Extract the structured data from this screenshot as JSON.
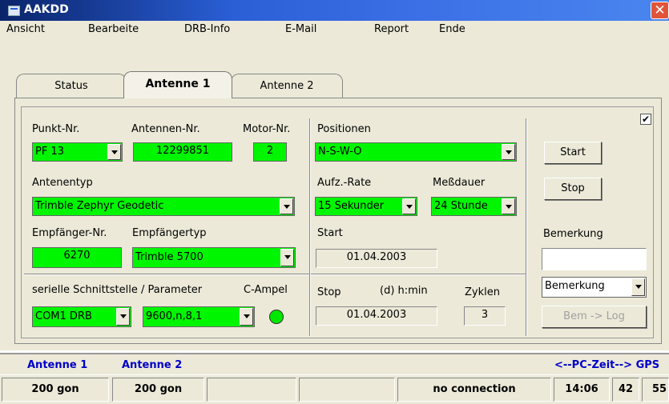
{
  "window": {
    "title": "AAKDD",
    "close_glyph": "✕"
  },
  "menu": [
    "Ansicht",
    "Bearbeite",
    "DRB-Info",
    "E-Mail",
    "Report",
    "Ende"
  ],
  "tabs": [
    {
      "label": "Status",
      "active": false
    },
    {
      "label": "Antenne 1",
      "active": true
    },
    {
      "label": "Antenne 2",
      "active": false
    }
  ],
  "form": {
    "punkt_label": "Punkt-Nr.",
    "punkt_value": "PF 13",
    "antennen_nr_label": "Antennen-Nr.",
    "antennen_nr_value": "12299851",
    "motor_label": "Motor-Nr.",
    "motor_value": "2",
    "antennentyp_label": "Antenentyp",
    "antennentyp_value": "Trimble Zephyr Geodetic",
    "empf_nr_label": "Empfänger-Nr.",
    "empf_nr_value": "6270",
    "empf_typ_label": "Empfängertyp",
    "empf_typ_value": "Trimble 5700",
    "seriell_label": "serielle Schnittstelle / Parameter",
    "com_value": "COM1 DRB",
    "params_value": "9600,n,8,1",
    "ampel_label": "C-Ampel",
    "positionen_label": "Positionen",
    "positionen_value": "N-S-W-O",
    "rate_label": "Aufz.-Rate",
    "rate_value": "15 Sekunder",
    "dauer_label": "Meßdauer",
    "dauer_value": "24 Stunde",
    "start_label": "Start",
    "start_value": "01.04.2003",
    "stop_label": "Stop",
    "dhmin_label": "(d) h:min",
    "stop_value": "01.04.2003",
    "zyklen_label": "Zyklen",
    "zyklen_value": "3",
    "start_button": "Start",
    "stop_button": "Stop",
    "bemerkung_label": "Bemerkung",
    "bemerkung_input": "",
    "bemerkung_select": "Bemerkung",
    "bem_log_button": "Bem -> Log",
    "checkbox_checked": true,
    "check_glyph": "✔"
  },
  "statusbar_top": {
    "antenne1": "Antenne 1",
    "antenne2": "Antenne 2",
    "pc_zeit": "<--PC-Zeit--> GPS"
  },
  "statusbar_bottom": {
    "a1_gon": "200 gon",
    "a2_gon": "200 gon",
    "connection": "no connection",
    "hhmm": "14:06",
    "mm": "42",
    "ss": "55"
  },
  "colors": {
    "field_green": "#00f600",
    "title_blue": "#2a5fd6",
    "status_text": "#0000c8"
  }
}
